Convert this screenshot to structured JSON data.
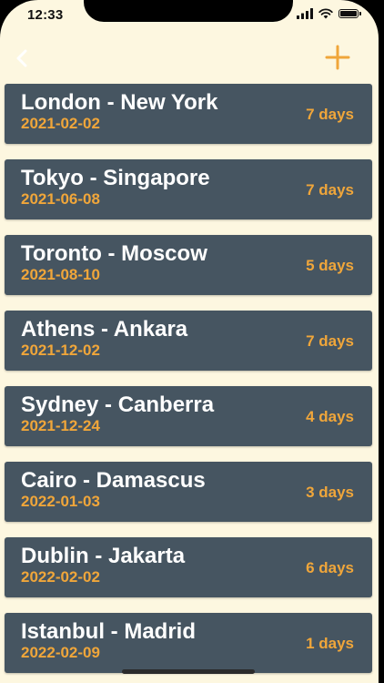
{
  "status_bar": {
    "time": "12:33",
    "icons": [
      "signal-icon",
      "wifi-icon",
      "battery-icon"
    ]
  },
  "navbar": {
    "back_icon": "chevron-left-icon",
    "add_icon": "plus-icon"
  },
  "colors": {
    "background": "#fdf7e0",
    "card": "#465561",
    "accent": "#f0a63a",
    "title_text": "#ffffff"
  },
  "trips": [
    {
      "route": "London - New York",
      "date": "2021-02-02",
      "duration": "7 days"
    },
    {
      "route": "Tokyo - Singapore",
      "date": "2021-06-08",
      "duration": "7 days"
    },
    {
      "route": "Toronto - Moscow",
      "date": "2021-08-10",
      "duration": "5 days"
    },
    {
      "route": "Athens - Ankara",
      "date": "2021-12-02",
      "duration": "7 days"
    },
    {
      "route": "Sydney - Canberra",
      "date": "2021-12-24",
      "duration": "4 days"
    },
    {
      "route": "Cairo - Damascus",
      "date": "2022-01-03",
      "duration": "3 days"
    },
    {
      "route": "Dublin - Jakarta",
      "date": "2022-02-02",
      "duration": "6 days"
    },
    {
      "route": "Istanbul - Madrid",
      "date": "2022-02-09",
      "duration": "1 days"
    }
  ]
}
